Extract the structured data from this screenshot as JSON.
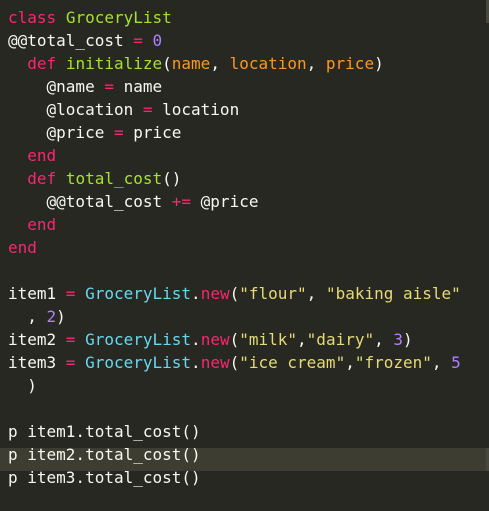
{
  "editor": {
    "theme_colors": {
      "background": "#272822",
      "current_line": "#3e3d32",
      "keyword": "#f92672",
      "class_name": "#a6e22e",
      "function_name": "#a6e22e",
      "parameter": "#fd971f",
      "number": "#ae81ff",
      "string": "#e6db74",
      "constant": "#66d9ef",
      "plain": "#f8f8f2"
    },
    "lines": [
      [
        {
          "t": "class",
          "c": "kw"
        },
        {
          "t": " ",
          "c": "plain"
        },
        {
          "t": "GroceryList",
          "c": "cls"
        }
      ],
      [
        {
          "t": "@@total_cost",
          "c": "plain"
        },
        {
          "t": " ",
          "c": "plain"
        },
        {
          "t": "=",
          "c": "op"
        },
        {
          "t": " ",
          "c": "plain"
        },
        {
          "t": "0",
          "c": "num"
        }
      ],
      [
        {
          "t": "  ",
          "c": "plain"
        },
        {
          "t": "def",
          "c": "kw"
        },
        {
          "t": " ",
          "c": "plain"
        },
        {
          "t": "initialize",
          "c": "fn"
        },
        {
          "t": "(",
          "c": "plain"
        },
        {
          "t": "name",
          "c": "param"
        },
        {
          "t": ", ",
          "c": "plain"
        },
        {
          "t": "location",
          "c": "param"
        },
        {
          "t": ", ",
          "c": "plain"
        },
        {
          "t": "price",
          "c": "param"
        },
        {
          "t": ")",
          "c": "plain"
        }
      ],
      [
        {
          "t": "    @name ",
          "c": "plain"
        },
        {
          "t": "=",
          "c": "op"
        },
        {
          "t": " name",
          "c": "plain"
        }
      ],
      [
        {
          "t": "    @location ",
          "c": "plain"
        },
        {
          "t": "=",
          "c": "op"
        },
        {
          "t": " location",
          "c": "plain"
        }
      ],
      [
        {
          "t": "    @price ",
          "c": "plain"
        },
        {
          "t": "=",
          "c": "op"
        },
        {
          "t": " price",
          "c": "plain"
        }
      ],
      [
        {
          "t": "  ",
          "c": "plain"
        },
        {
          "t": "end",
          "c": "kw"
        }
      ],
      [
        {
          "t": "  ",
          "c": "plain"
        },
        {
          "t": "def",
          "c": "kw"
        },
        {
          "t": " ",
          "c": "plain"
        },
        {
          "t": "total_cost",
          "c": "fn"
        },
        {
          "t": "()",
          "c": "plain"
        }
      ],
      [
        {
          "t": "    @@total_cost ",
          "c": "plain"
        },
        {
          "t": "+=",
          "c": "op"
        },
        {
          "t": " @price",
          "c": "plain"
        }
      ],
      [
        {
          "t": "  ",
          "c": "plain"
        },
        {
          "t": "end",
          "c": "kw"
        }
      ],
      [
        {
          "t": "end",
          "c": "kw"
        }
      ],
      [],
      [
        {
          "t": "item1 ",
          "c": "plain"
        },
        {
          "t": "=",
          "c": "op"
        },
        {
          "t": " ",
          "c": "plain"
        },
        {
          "t": "GroceryList",
          "c": "const"
        },
        {
          "t": ".",
          "c": "plain"
        },
        {
          "t": "new",
          "c": "kw"
        },
        {
          "t": "(",
          "c": "plain"
        },
        {
          "t": "\"flour\"",
          "c": "str"
        },
        {
          "t": ", ",
          "c": "plain"
        },
        {
          "t": "\"baking aisle\"",
          "c": "str"
        }
      ],
      [
        {
          "t": "  , ",
          "c": "plain"
        },
        {
          "t": "2",
          "c": "num"
        },
        {
          "t": ")",
          "c": "plain"
        }
      ],
      [
        {
          "t": "item2 ",
          "c": "plain"
        },
        {
          "t": "=",
          "c": "op"
        },
        {
          "t": " ",
          "c": "plain"
        },
        {
          "t": "GroceryList",
          "c": "const"
        },
        {
          "t": ".",
          "c": "plain"
        },
        {
          "t": "new",
          "c": "kw"
        },
        {
          "t": "(",
          "c": "plain"
        },
        {
          "t": "\"milk\"",
          "c": "str"
        },
        {
          "t": ",",
          "c": "plain"
        },
        {
          "t": "\"dairy\"",
          "c": "str"
        },
        {
          "t": ", ",
          "c": "plain"
        },
        {
          "t": "3",
          "c": "num"
        },
        {
          "t": ")",
          "c": "plain"
        }
      ],
      [
        {
          "t": "item3 ",
          "c": "plain"
        },
        {
          "t": "=",
          "c": "op"
        },
        {
          "t": " ",
          "c": "plain"
        },
        {
          "t": "GroceryList",
          "c": "const"
        },
        {
          "t": ".",
          "c": "plain"
        },
        {
          "t": "new",
          "c": "kw"
        },
        {
          "t": "(",
          "c": "plain"
        },
        {
          "t": "\"ice cream\"",
          "c": "str"
        },
        {
          "t": ",",
          "c": "plain"
        },
        {
          "t": "\"frozen\"",
          "c": "str"
        },
        {
          "t": ", ",
          "c": "plain"
        },
        {
          "t": "5",
          "c": "num"
        }
      ],
      [
        {
          "t": "  )",
          "c": "plain"
        }
      ],
      [],
      [
        {
          "t": "p item1.total_cost()",
          "c": "plain"
        }
      ],
      [
        {
          "t": "p item2.total_cost()",
          "c": "plain"
        }
      ],
      [
        {
          "t": "p item3.total_cost()",
          "c": "plain"
        }
      ]
    ]
  }
}
